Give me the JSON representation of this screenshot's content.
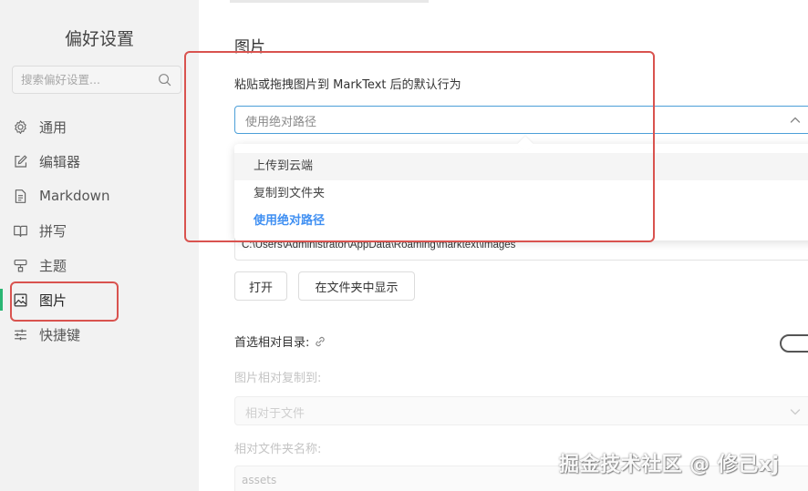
{
  "sidebar": {
    "title": "偏好设置",
    "search_placeholder": "搜索偏好设置...",
    "items": [
      {
        "label": "通用",
        "icon": "gear-icon"
      },
      {
        "label": "编辑器",
        "icon": "edit-icon"
      },
      {
        "label": "Markdown",
        "icon": "document-icon"
      },
      {
        "label": "拼写",
        "icon": "book-icon"
      },
      {
        "label": "主题",
        "icon": "paint-roller-icon"
      },
      {
        "label": "图片",
        "icon": "image-icon",
        "active": true
      },
      {
        "label": "快捷键",
        "icon": "sliders-icon"
      }
    ]
  },
  "main": {
    "title": "图片",
    "paste_behavior_label": "粘贴或拖拽图片到 MarkText 后的默认行为",
    "paste_behavior_value": "使用绝对路径",
    "dropdown_options": [
      {
        "label": "上传到云端",
        "state": "hover"
      },
      {
        "label": "复制到文件夹",
        "state": "normal"
      },
      {
        "label": "使用绝对路径",
        "state": "selected"
      }
    ],
    "image_folder_path": "C:\\Users\\Administrator\\AppData\\Roaming\\marktext\\images",
    "open_button": "打开",
    "show_in_folder_button": "在文件夹中显示",
    "prefer_relative_label": "首选相对目录:",
    "relative_copy_label": "图片相对复制到:",
    "relative_copy_value": "相对于文件",
    "relative_folder_label": "相对文件夹名称:",
    "relative_folder_value": "assets"
  },
  "watermark": "掘金技术社区 @ 修己xj",
  "colors": {
    "sidebar_bg": "#f2f2f2",
    "active_indicator": "#2bb673",
    "selected_option": "#3f8ff2",
    "focus_border": "#4c9fd8",
    "annotation_red": "#d9534f"
  }
}
